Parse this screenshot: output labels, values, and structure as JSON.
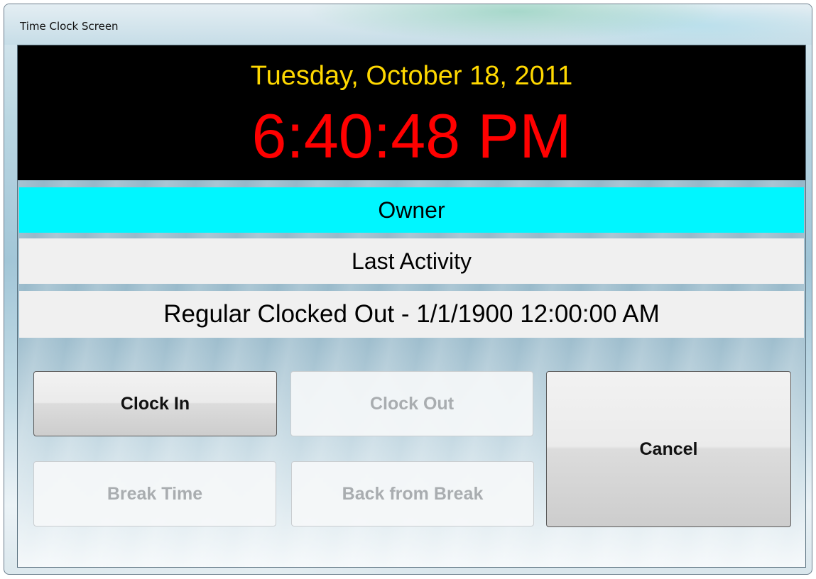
{
  "window": {
    "title": "Time Clock Screen"
  },
  "clock": {
    "date": "Tuesday, October 18, 2011",
    "time": "6:40:48 PM",
    "date_color": "#ffd800",
    "time_color": "#ff0000"
  },
  "employee": {
    "name": "Owner",
    "highlight_color": "#00f6ff"
  },
  "activity": {
    "label": "Last Activity",
    "value": "Regular Clocked Out - 1/1/1900 12:00:00 AM"
  },
  "buttons": {
    "clock_in": {
      "label": "Clock In",
      "enabled": true
    },
    "clock_out": {
      "label": "Clock Out",
      "enabled": false
    },
    "break_time": {
      "label": "Break Time",
      "enabled": false
    },
    "back_from_break": {
      "label": "Back from Break",
      "enabled": false
    },
    "cancel": {
      "label": "Cancel",
      "enabled": true
    }
  }
}
